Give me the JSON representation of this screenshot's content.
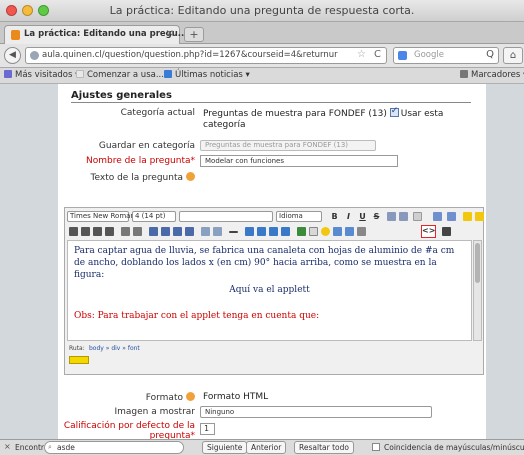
{
  "window": {
    "title": "La práctica: Editando una pregunta de respuesta corta."
  },
  "tabs": [
    {
      "label": "La práctica: Editando una pregu...",
      "close": "×"
    }
  ],
  "new_tab": "+",
  "nav": {
    "back": "◀",
    "url": "aula.quinen.cl/question/question.php?id=1267&courseid=4&returnur",
    "url_star": "☆",
    "url_reload": "C",
    "search_placeholder": "Google",
    "search_go": "Q",
    "home": "⌂"
  },
  "bookmarks": {
    "items": [
      {
        "label": "Más visitados ▾",
        "icon_color": "#6a6ad0"
      },
      {
        "label": "Comenzar a usa...",
        "icon_color": "#e9e9e9"
      },
      {
        "label": "Últimas noticias ▾",
        "icon_color": "#3a7bd5"
      }
    ],
    "right": "Marcadores ▾"
  },
  "form": {
    "section_title": "Ajustes generales",
    "current_category_label": "Categoría actual",
    "current_category_value": "Preguntas de muestra para FONDEF (13)",
    "use_category_label": "Usar esta categoría",
    "save_category_label": "Guardar en categoría",
    "save_category_select": "Preguntas de muestra para FONDEF (13)",
    "question_name_label": "Nombre de la pregunta",
    "question_name_value": "Modelar con funciones",
    "question_text_label": "Texto de la pregunta",
    "format_label": "Formato",
    "format_value": "Formato HTML",
    "image_label": "Imagen a mostrar",
    "image_value": "Ninguno",
    "grade_label": "Calificación por defecto de la pregunta",
    "grade_value": "1",
    "required_mark": "*"
  },
  "editor": {
    "font_family": "Times New Roman",
    "font_size": "4 (14 pt)",
    "style_select": "",
    "language": "Idioma",
    "bold": "B",
    "italic": "I",
    "underline": "U",
    "strike": "S",
    "html_source": "<>",
    "paragraph1": "Para captar agua de lluvia, se fabrica una canaleta con hojas de aluminio de #a cm de ancho, doblando los lados x (en cm) 90° hacia arriba, como se muestra en la figura:",
    "paragraph2": "Aquí va el applett",
    "paragraph3": "Obs: Para trabajar con el applet tenga en cuenta que:",
    "path_label": "Ruta:",
    "path_value": "body » div » font"
  },
  "findbar": {
    "close": "×",
    "label": "Encontrar:",
    "value": "asde",
    "next": "Siguiente",
    "prev": "Anterior",
    "highlight": "Resaltar todo",
    "match_case": "Coincidencia de mayúsculas/minúsculas"
  },
  "colors": {
    "required": "#cc0000",
    "editor_text": "#1a2d6b",
    "source_highlight": "#e0262a",
    "help_icon": "#f0a23a"
  }
}
